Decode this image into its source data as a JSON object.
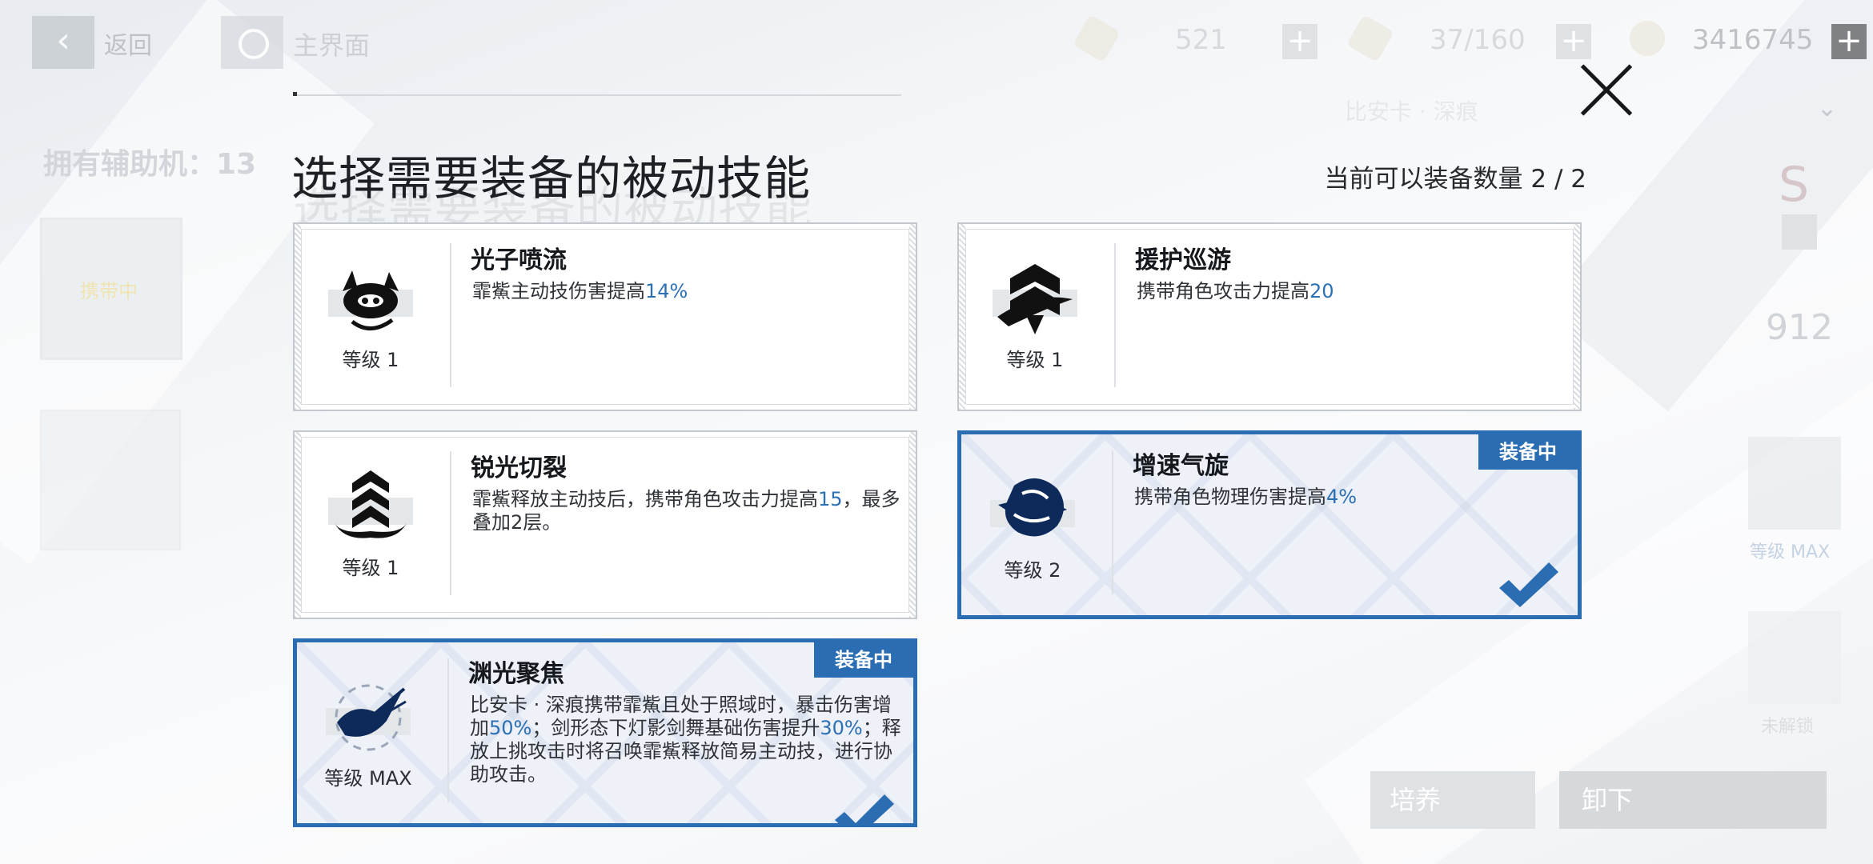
{
  "topbar": {
    "back_label": "返回",
    "home_label": "主界面",
    "resources": [
      {
        "icon": "energy-ticket-icon",
        "value": "521"
      },
      {
        "icon": "stamina-icon",
        "value": "37/160"
      },
      {
        "icon": "currency-coin-icon",
        "value": "3416745"
      }
    ]
  },
  "background": {
    "owned_label": "拥有辅助机：13",
    "left_card_status": "携带中",
    "right_grade": "S",
    "right_value": "912",
    "right_slot_level": "等级 MAX",
    "right_locked": "未解锁",
    "right_dropdown": "比安卡 · 深痕",
    "train_button": "培养",
    "unequip_button": "卸下"
  },
  "modal": {
    "title": "选择需要装备的被动技能",
    "count_label": "当前可以装备数量  2 / 2",
    "equipped_badge": "装备中",
    "skills": [
      {
        "name": "光子喷流",
        "level": "等级  1",
        "equipped": false,
        "desc": [
          {
            "t": "霏鮆主动技伤害提高"
          },
          {
            "t": "14%",
            "hl": true
          }
        ]
      },
      {
        "name": "援护巡游",
        "level": "等级  1",
        "equipped": false,
        "desc": [
          {
            "t": "携带角色攻击力提高"
          },
          {
            "t": "20",
            "hl": true
          }
        ]
      },
      {
        "name": "锐光切裂",
        "level": "等级  1",
        "equipped": false,
        "desc": [
          {
            "t": "霏鮆释放主动技后，携带角色攻击力提高"
          },
          {
            "t": "15",
            "hl": true
          },
          {
            "t": "，最多叠加2层。"
          }
        ]
      },
      {
        "name": "增速气旋",
        "level": "等级  2",
        "equipped": true,
        "desc": [
          {
            "t": "携带角色物理伤害提高"
          },
          {
            "t": "4%",
            "hl": true
          }
        ]
      },
      {
        "name": "渊光聚焦",
        "level": "等级  MAX",
        "equipped": true,
        "desc": [
          {
            "t": "比安卡 · 深痕携带霏鮆且处于照域时，暴击伤害增加"
          },
          {
            "t": "50%",
            "hl": true
          },
          {
            "t": "；剑形态下灯影剑舞基础伤害提升"
          },
          {
            "t": "30%",
            "hl": true
          },
          {
            "t": "；释放上挑攻击时将召唤霏鮆释放简易主动技，进行协助攻击。"
          }
        ]
      }
    ]
  },
  "colors": {
    "accent": "#2a6db2",
    "highlight_text": "#2b6fb4",
    "title_text": "#1c1f23"
  }
}
